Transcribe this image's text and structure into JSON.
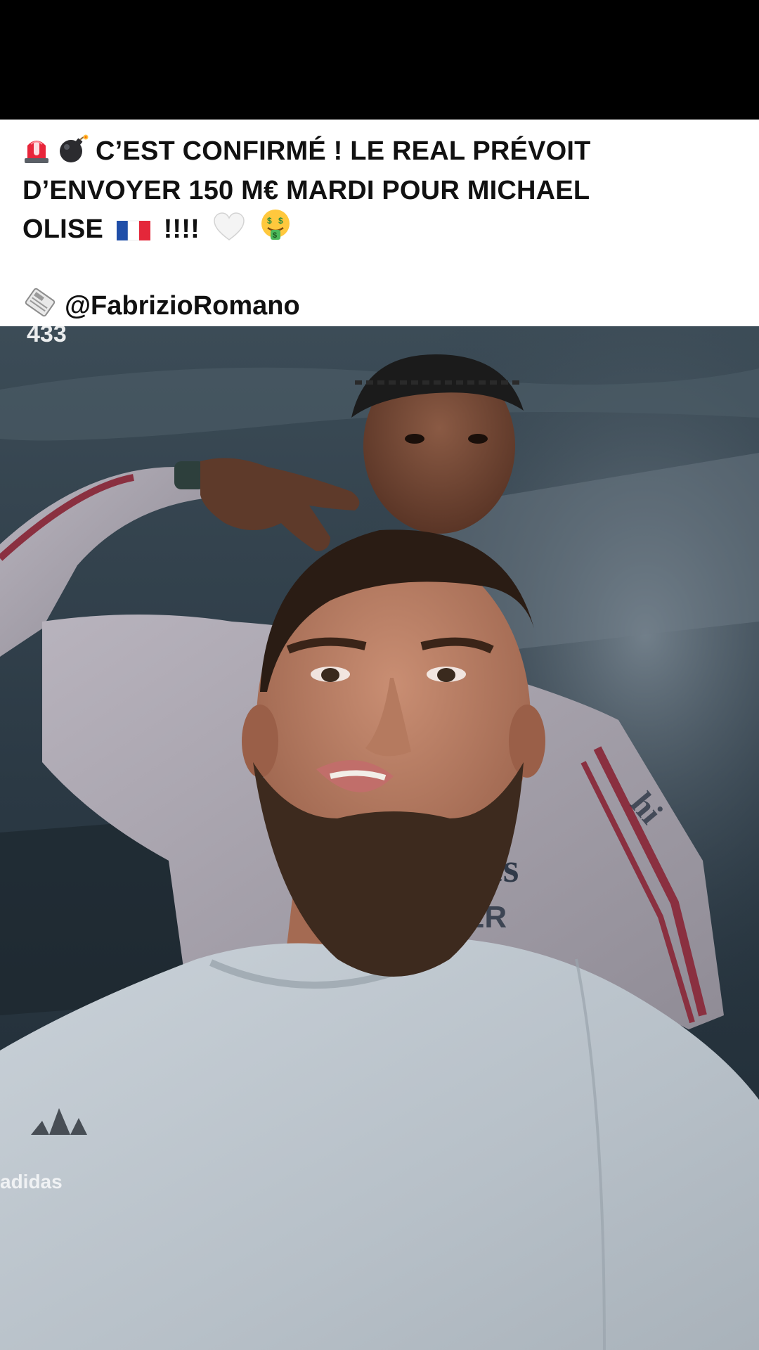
{
  "post": {
    "caption_line1": "C’EST CONFIRMÉ ! LE REAL PRÉVOIT",
    "caption_line2": "D’ENVOYER 150 M€ MARDI POUR MICHAEL",
    "caption_line3_text": "OLISE",
    "caption_line3_exclaim": "!!!!",
    "source_handle": "@FabrizioRomano",
    "caption_emojis": [
      "siren-emoji",
      "bomb-emoji",
      "france-flag-emoji",
      "white-heart-emoji",
      "money-mouth-face-emoji",
      "newspaper-emoji"
    ]
  },
  "video": {
    "watermark": "433",
    "shirt_logo_text": "adidas",
    "jersey_text_1": "es",
    "jersey_text_2": "ER",
    "jersey_text_3": "hi"
  },
  "colors": {
    "caption_bg": "#ffffff",
    "caption_text": "#111111",
    "top_bar": "#000000",
    "jersey_stripe": "#8a3040"
  }
}
